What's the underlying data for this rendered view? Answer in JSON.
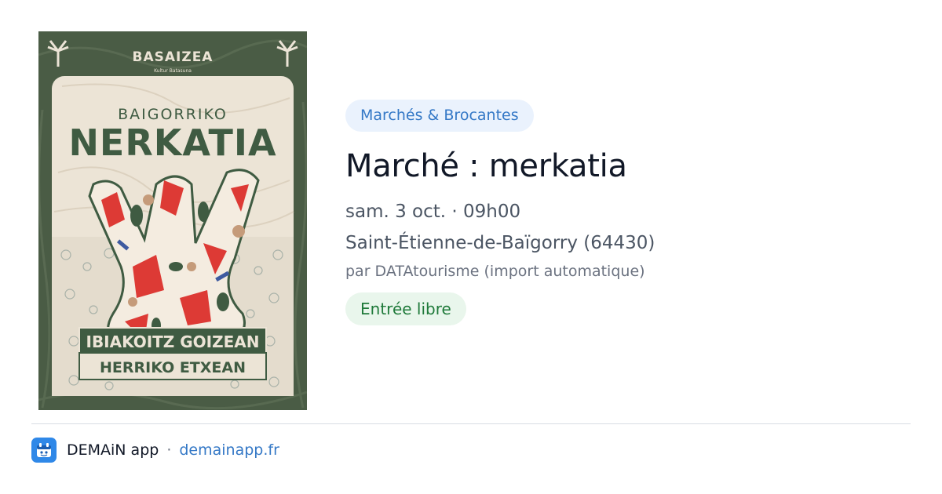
{
  "poster": {
    "brand": "BASAIZEA",
    "brand_sub": "Kultur Batasuna",
    "title_line1": "BAIGORRIKO",
    "title_line2": "NERKATIA",
    "banner_line1": "IBIAKOITZ GOIZEAN",
    "banner_line2": "HERRIKO ETXEAN",
    "colors": {
      "frame": "#4a5c45",
      "paper": "#ece4d6",
      "red": "#dd3a35",
      "green": "#3f5b42"
    }
  },
  "event": {
    "category": "Marchés & Brocantes",
    "title": "Marché : merkatia",
    "datetime": "sam. 3 oct. · 09h00",
    "location": "Saint-Étienne-de-Baïgorry (64430)",
    "source": "par DATAtourisme (import automatique)",
    "price": "Entrée libre"
  },
  "footer": {
    "app_name": "DEMAiN app",
    "separator": "·",
    "domain": "demainapp.fr",
    "icon": "demain-app-icon"
  },
  "theme": {
    "accent": "#3478c6",
    "success": "#1f7a3a"
  }
}
